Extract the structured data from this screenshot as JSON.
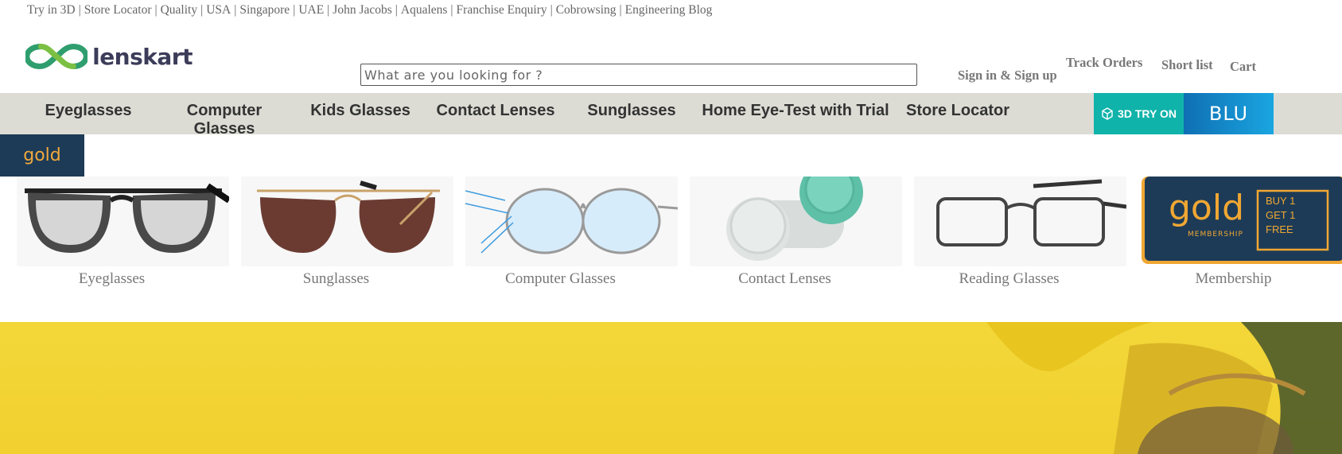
{
  "topbar": {
    "links": [
      "Try in 3D",
      "Store Locator",
      "Quality",
      "USA",
      "Singapore",
      "UAE",
      "John Jacobs",
      "Aqualens",
      "Franchise Enquiry",
      "Cobrowsing",
      "Engineering Blog"
    ]
  },
  "header": {
    "logo_text": "lenskart",
    "search_placeholder": "What are you looking for ?",
    "signin": "Sign in & Sign up",
    "track_orders": "Track Orders",
    "short_list": "Short list",
    "cart": "Cart"
  },
  "nav": {
    "items": [
      "Eyeglasses",
      "Computer Glasses",
      "Kids Glasses",
      "Contact Lenses",
      "Sunglasses",
      "Home Eye-Test with Trial",
      "Store Locator"
    ],
    "try_3d": "3D TRY ON",
    "blu": "BLU",
    "gold": "gold"
  },
  "categories": [
    {
      "label": "Eyeglasses"
    },
    {
      "label": "Sunglasses"
    },
    {
      "label": "Computer Glasses"
    },
    {
      "label": "Contact Lenses"
    },
    {
      "label": "Reading Glasses"
    },
    {
      "label": "Membership"
    }
  ],
  "membership_badge": {
    "word": "gold",
    "sub": "MEMBERSHIP",
    "offer": [
      "BUY 1",
      "GET 1",
      "FREE"
    ]
  },
  "colors": {
    "nav_bg": "#dcdcd5",
    "teal": "#10b3aa",
    "blu": "#1aa6e0",
    "gold_bg": "#1d3b57",
    "gold": "#f2a93b",
    "banner": "#f1d02f"
  }
}
